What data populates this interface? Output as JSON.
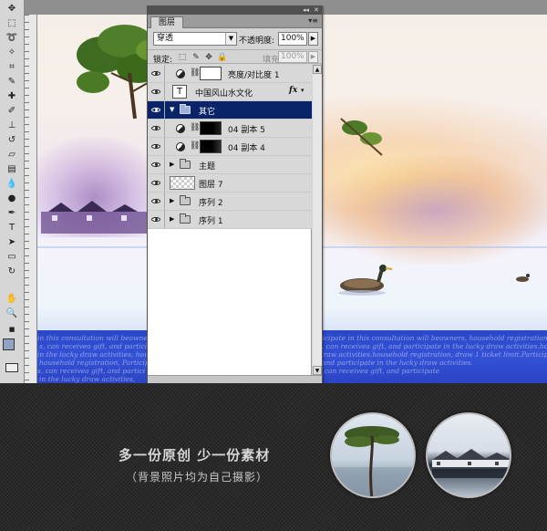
{
  "layers_panel": {
    "tab_label": "图层",
    "collapse_glyph": "◂◂",
    "close_glyph": "✕",
    "menu_glyph": "▾≡",
    "blend_mode": "穿透",
    "opacity_label": "不透明度:",
    "opacity_value": "100%",
    "lock_label": "锁定:",
    "fill_label": "填充:",
    "fill_value": "100%",
    "layers": [
      {
        "name": "亮度/对比度 1",
        "kind": "adjustment",
        "selected": false
      },
      {
        "name": "中国风山水文化",
        "kind": "text",
        "selected": false,
        "fx": "fx"
      },
      {
        "name": "其它",
        "kind": "group",
        "selected": true
      },
      {
        "name": "04 副本 5",
        "kind": "adjustment-masked",
        "selected": false
      },
      {
        "name": "04 副本 4",
        "kind": "adjustment-masked",
        "selected": false
      },
      {
        "name": "主题",
        "kind": "group",
        "selected": false
      },
      {
        "name": "图层 7",
        "kind": "pixel",
        "selected": false
      },
      {
        "name": "序列 2",
        "kind": "group",
        "selected": false
      },
      {
        "name": "序列 1",
        "kind": "group",
        "selected": false
      }
    ]
  },
  "canvas": {
    "strip_lines": [
      "in this consultation will beowners, household registration, draw 1 ticket limit.Participate in this consultation will beowners, household registration, draw 1 ticket limit.Participate in this",
      "s, can receivea gift, and partici limitParticipate in this consultation will beowners, can receivea gift, and participate in the lucky draw activities.household",
      "in the lucky draw activities, househ registration, draw 1 ticket limit. in the lucky draw activities.household registration, draw 1 ticket limit.Participate in this",
      "household registration, Participate consultation will beowners, can receivea gift, and participate in the lucky draw activities.",
      "s, can receivea gift, and partici limitParticipate in this consultation will beowners, can receivea gift, and participate",
      "in the lucky draw activities,"
    ]
  },
  "banner": {
    "title": "多一份原创 少一份素材",
    "subtitle": "（背景照片均为自己摄影）"
  }
}
